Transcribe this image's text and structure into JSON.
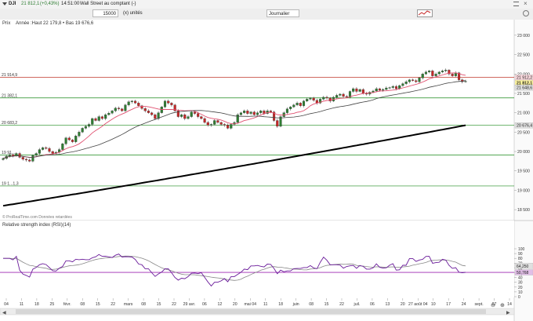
{
  "header": {
    "symbol": "DJI",
    "price": "21 812,1",
    "change": "(+0,43%)",
    "time": "14:51:00",
    "market": "Wall Street au comptant (-)"
  },
  "toolbar": {
    "quantity": "15000",
    "unit": "(x) unités",
    "period": "Journalier"
  },
  "main_panel": {
    "label": "Prix",
    "stats": "Année :Haut 22 179,8 • Bas 19 676,6",
    "copyright": "© ProRealTime.com Données retardées",
    "y_ticks": [
      "23 000",
      "22 500",
      "22 000",
      "21 500",
      "21 000",
      "20 500",
      "20 000",
      "19 500",
      "19 000",
      "18 500"
    ],
    "level_labels": [
      "21 914,9",
      "21 382,1",
      "20 683,2",
      "19 91...",
      "19 1...1,3"
    ],
    "right_tags": [
      "21 912,2",
      "21 812,1",
      "21 648,6",
      "20 676,4"
    ],
    "colors": {
      "up": "#2e7d32",
      "down": "#c62828",
      "ma_fast": "#e05070",
      "ma_mid": "#444444",
      "ma_slow": "#000000",
      "level": "#1b8a1b",
      "level_top": "#c0392b"
    }
  },
  "rsi_panel": {
    "title": "Relative strength index (RSI)(14)",
    "y_ticks": [
      "100",
      "90",
      "80",
      "70",
      "60",
      "50",
      "40",
      "30",
      "20",
      "10",
      "0"
    ],
    "right_tags": [
      "64,250",
      "50,768"
    ],
    "colors": {
      "rsi": "#6a1b9a",
      "signal": "#888888",
      "ref_line": "#9c27b0"
    }
  },
  "x_axis": {
    "labels": [
      "04",
      "11",
      "18",
      "25",
      "févr.",
      "08",
      "15",
      "22",
      "mars",
      "08",
      "15",
      "22",
      "29 avr.",
      "06",
      "12",
      "20",
      "mai 04",
      "11",
      "18",
      "juin",
      "08",
      "15",
      "22",
      "juil.",
      "06",
      "13",
      "20",
      "27 août 04",
      "10",
      "17",
      "24",
      "sept.",
      "07",
      "14"
    ]
  },
  "chart_data": {
    "type": "candlestick",
    "title": "",
    "x_range": [
      "04 janv.",
      "14 sept."
    ],
    "ylim": [
      18300,
      23200
    ],
    "annual_high": 22179.8,
    "annual_low": 19676.6,
    "last_close": 21812.1,
    "ohlc_closes": [
      19820,
      19880,
      19920,
      19890,
      19950,
      19850,
      19800,
      19780,
      19750,
      19900,
      19950,
      20050,
      20100,
      20080,
      20000,
      19950,
      19980,
      20050,
      20200,
      20350,
      20300,
      20250,
      20400,
      20500,
      20600,
      20650,
      20700,
      20850,
      20800,
      20900,
      20850,
      20950,
      20990,
      21050,
      21120,
      21100,
      21050,
      21200,
      21280,
      21300,
      21250,
      21180,
      21110,
      21050,
      21000,
      20950,
      20850,
      21000,
      21150,
      21300,
      21250,
      21200,
      21050,
      20900,
      20950,
      20850,
      20900,
      21020,
      20980,
      20900,
      20850,
      20750,
      20680,
      20700,
      20800,
      20750,
      20700,
      20680,
      20600,
      20700,
      20750,
      20950,
      21000,
      21050,
      20980,
      21020,
      20950,
      21000,
      21050,
      20980,
      21050,
      21020,
      20800,
      20650,
      20900,
      21000,
      21100,
      21150,
      21200,
      21250,
      21180,
      21300,
      21350,
      21380,
      21320,
      21250,
      21350,
      21400,
      21380,
      21300,
      21400,
      21450,
      21480,
      21420,
      21400,
      21550,
      21620,
      21550,
      21600,
      21500,
      21480,
      21530,
      21560,
      21620,
      21580,
      21600,
      21640,
      21650,
      21680,
      21620,
      21700,
      21750,
      21800,
      21850,
      21830,
      21800,
      21900,
      22000,
      22050,
      22080,
      21950,
      22000,
      22050,
      22080,
      22100,
      22000,
      21950,
      22030,
      21850,
      21800,
      21812
    ],
    "ma_fast_end": 21912.2,
    "ma_mid_end": 21648.6,
    "ma_slow_end": 20676.4,
    "horizontal_levels": [
      21914.9,
      21382.1,
      20683.2,
      19910,
      19111.3
    ],
    "rsi_series": {
      "name": "RSI(14)",
      "last": 50.768,
      "signal_last": 64.25,
      "ylim": [
        0,
        100
      ]
    }
  }
}
